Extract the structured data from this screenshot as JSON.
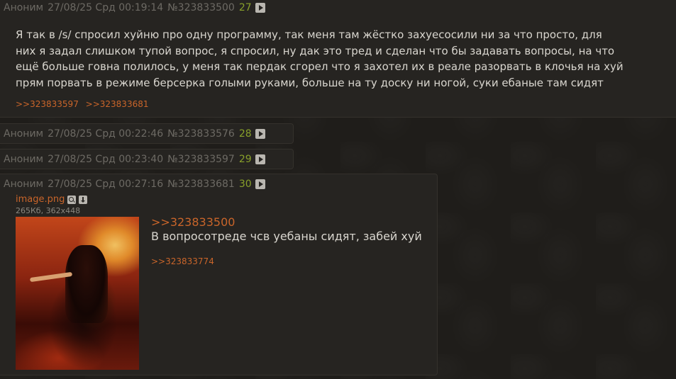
{
  "posts": [
    {
      "author": "Аноним",
      "date": "27/08/25 Срд 00:19:14",
      "num": "№323833500",
      "order": "27",
      "text_lines": [
        "Я так в /s/ спросил хуйню про одну программу, так меня там жёстко захуесосили ни за что просто, для",
        "них я задал слишком тупой вопрос, я спросил, ну дак это тред и сделан что бы задавать вопросы, на что",
        "ещё больше говна полилось, у меня так пердак сгорел что я захотел их в реале разорвать в клочья на хуй",
        "прям порвать в режиме берсерка голыми руками, больше на ту доску ни ногой, суки ебаные там сидят"
      ],
      "replies": [
        ">>323833597",
        ">>323833681"
      ]
    },
    {
      "author": "Аноним",
      "date": "27/08/25 Срд 00:22:46",
      "num": "№323833576",
      "order": "28"
    },
    {
      "author": "Аноним",
      "date": "27/08/25 Срд 00:23:40",
      "num": "№323833597",
      "order": "29"
    },
    {
      "author": "Аноним",
      "date": "27/08/25 Срд 00:27:16",
      "num": "№323833681",
      "order": "30",
      "file": {
        "name": "image.png",
        "meta": "265Кб, 362x448"
      },
      "quote_link": ">>323833500",
      "text": "В вопросотреде чсв уебаны сидят, забей хуй",
      "replies": [
        ">>323833774"
      ]
    }
  ],
  "colors": {
    "background": "#1f1d1a",
    "post_bg": "#262421",
    "link": "#c9652a",
    "order_num": "#88a02a",
    "meta_text": "#6d6a64"
  }
}
